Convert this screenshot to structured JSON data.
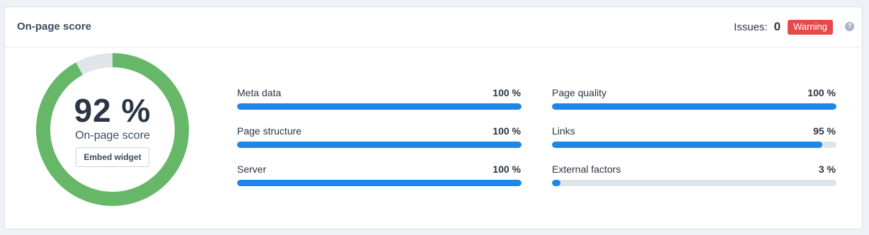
{
  "header": {
    "title": "On-page score",
    "issues_label": "Issues:",
    "issues_count": "0",
    "badge_label": "Warning",
    "help_glyph": "?"
  },
  "score": {
    "value_text": "92 %",
    "value": 92,
    "label": "On-page score",
    "embed_label": "Embed widget"
  },
  "metrics": [
    {
      "label": "Meta data",
      "value_text": "100 %",
      "value": 100
    },
    {
      "label": "Page structure",
      "value_text": "100 %",
      "value": 100
    },
    {
      "label": "Server",
      "value_text": "100 %",
      "value": 100
    },
    {
      "label": "Page quality",
      "value_text": "100 %",
      "value": 100
    },
    {
      "label": "Links",
      "value_text": "95 %",
      "value": 95
    },
    {
      "label": "External factors",
      "value_text": "3 %",
      "value": 3
    }
  ],
  "colors": {
    "donut_fill": "#66b868",
    "donut_track": "#e0e5ea",
    "bar_fill": "#1f86e8",
    "bar_track": "#dfe4e9",
    "warning": "#e64a4a"
  }
}
